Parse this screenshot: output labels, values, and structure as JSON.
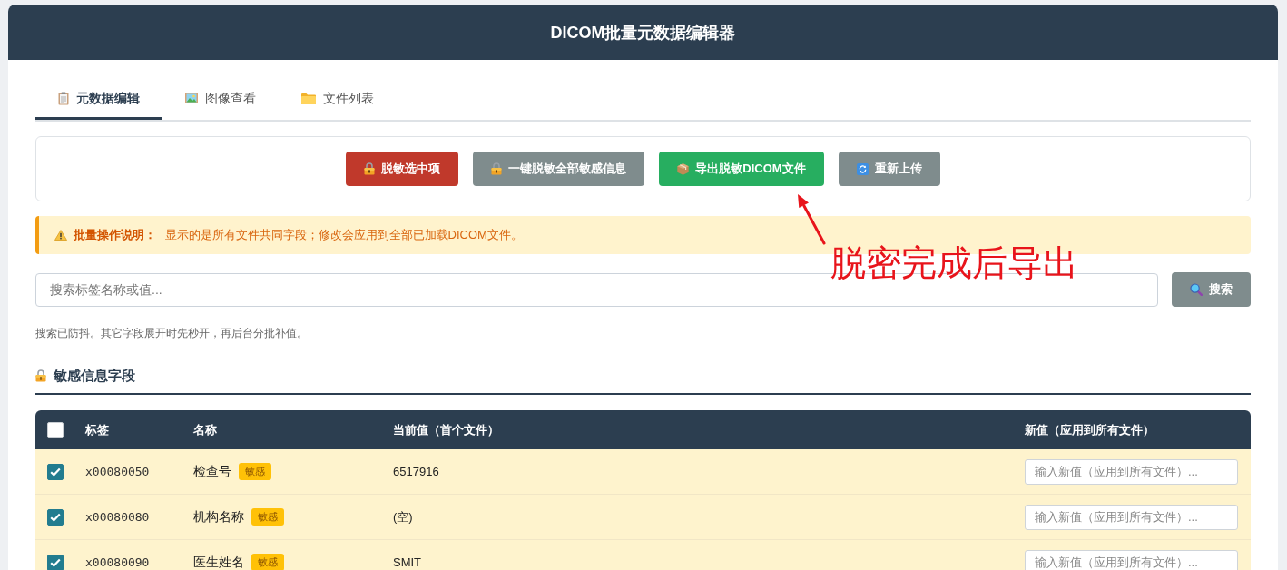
{
  "window": {
    "title": "DICOM批量元数据编辑器"
  },
  "tabs": [
    {
      "label": "元数据编辑",
      "selected": true
    },
    {
      "label": "图像查看",
      "selected": false
    },
    {
      "label": "文件列表",
      "selected": false
    }
  ],
  "actions": [
    {
      "label": "脱敏选中项",
      "color": "#c0392b"
    },
    {
      "label": "一键脱敏全部敏感信息",
      "color": "#7f8c8d"
    },
    {
      "label": "导出脱敏DICOM文件",
      "color": "#27ae60"
    },
    {
      "label": "重新上传",
      "color": "#7f8c8d"
    }
  ],
  "annotation": {
    "text": "脱密完成后导出"
  },
  "notice": {
    "text": "**批量操作说明：** 显示的是所有文件共同字段；修改会应用到全部已加载DICOM文件。"
  },
  "search": {
    "placeholder": "搜索标签名称或值...",
    "button": "搜索",
    "hint": "搜索已防抖。其它字段展开时先秒开，再后台分批补值。"
  },
  "section": {
    "title": "敏感信息字段"
  },
  "table": {
    "select_all": {
      "checked": false
    },
    "columns": [
      "标签",
      "名称",
      "当前值（首个文件）",
      "新值（应用到所有文件）"
    ],
    "rows": [
      {
        "checked": true,
        "tag": "x00080050",
        "name": "检查号",
        "badge": "敏感",
        "value": "6517916",
        "placeholder": "输入新值（应用到所有文件）..."
      },
      {
        "checked": true,
        "tag": "x00080080",
        "name": "机构名称",
        "badge": "敏感",
        "value": "(空)",
        "placeholder": "输入新值（应用到所有文件）..."
      },
      {
        "checked": true,
        "tag": "x00080090",
        "name": "医生姓名",
        "badge": "敏感",
        "value": "SMIT",
        "placeholder": "输入新值（应用到所有文件）..."
      }
    ]
  }
}
